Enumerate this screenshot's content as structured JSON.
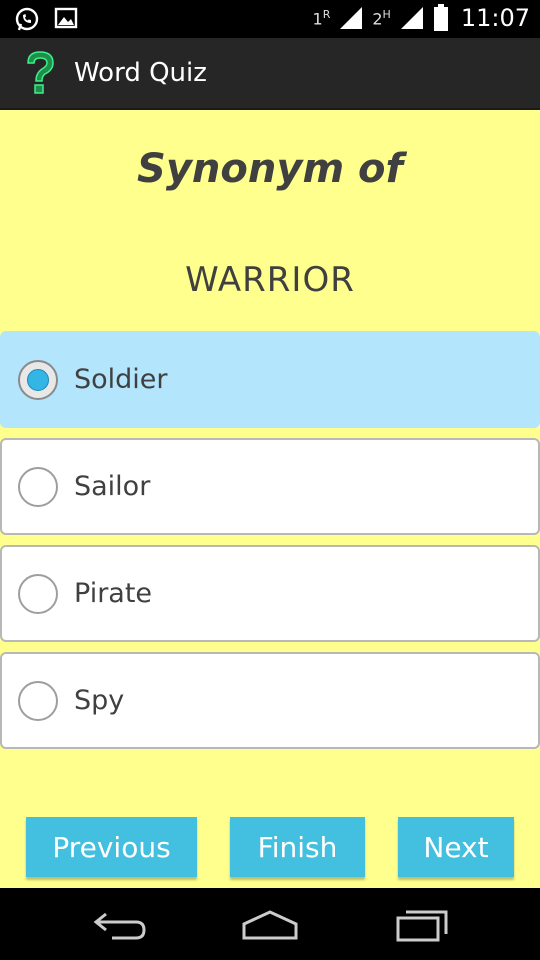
{
  "status_bar": {
    "sim1_label": "1",
    "sim1_type": "R",
    "sim2_label": "2",
    "sim2_type": "H",
    "time": "11:07",
    "icons": [
      "whatsapp-icon",
      "image-icon",
      "signal-icon",
      "battery-icon"
    ]
  },
  "app": {
    "title": "Word Quiz",
    "icon": "question-mark-icon",
    "icon_color": "#2ecc71"
  },
  "question": {
    "heading": "Synonym of",
    "word": "WARRIOR"
  },
  "options": [
    {
      "label": "Soldier",
      "selected": true
    },
    {
      "label": "Sailor",
      "selected": false
    },
    {
      "label": "Pirate",
      "selected": false
    },
    {
      "label": "Spy",
      "selected": false
    }
  ],
  "buttons": {
    "previous": "Previous",
    "finish": "Finish",
    "next": "Next"
  },
  "colors": {
    "background": "#ffff8d",
    "selected_option": "#b3e5fc",
    "button": "#43bfe0",
    "action_bar": "#262626"
  }
}
